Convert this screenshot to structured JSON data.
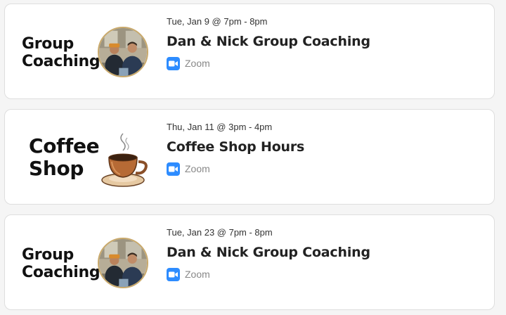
{
  "events": [
    {
      "thumb_line1": "Group",
      "thumb_line2": "Coaching",
      "thumb_image": "coaches-photo",
      "date": "Tue, Jan 9 @ 7pm - 8pm",
      "title": "Dan & Nick Group Coaching",
      "location_icon": "zoom-icon",
      "location": "Zoom"
    },
    {
      "thumb_line1": "Coffee",
      "thumb_line2": "Shop",
      "thumb_image": "coffee-cup-illustration",
      "date": "Thu, Jan 11 @ 3pm - 4pm",
      "title": "Coffee Shop Hours",
      "location_icon": "zoom-icon",
      "location": "Zoom"
    },
    {
      "thumb_line1": "Group",
      "thumb_line2": "Coaching",
      "thumb_image": "coaches-photo",
      "date": "Tue, Jan 23 @ 7pm - 8pm",
      "title": "Dan & Nick Group Coaching",
      "location_icon": "zoom-icon",
      "location": "Zoom"
    }
  ],
  "colors": {
    "zoom_blue": "#2d8cff",
    "card_border": "#dedede",
    "background": "#f5f5f5"
  }
}
